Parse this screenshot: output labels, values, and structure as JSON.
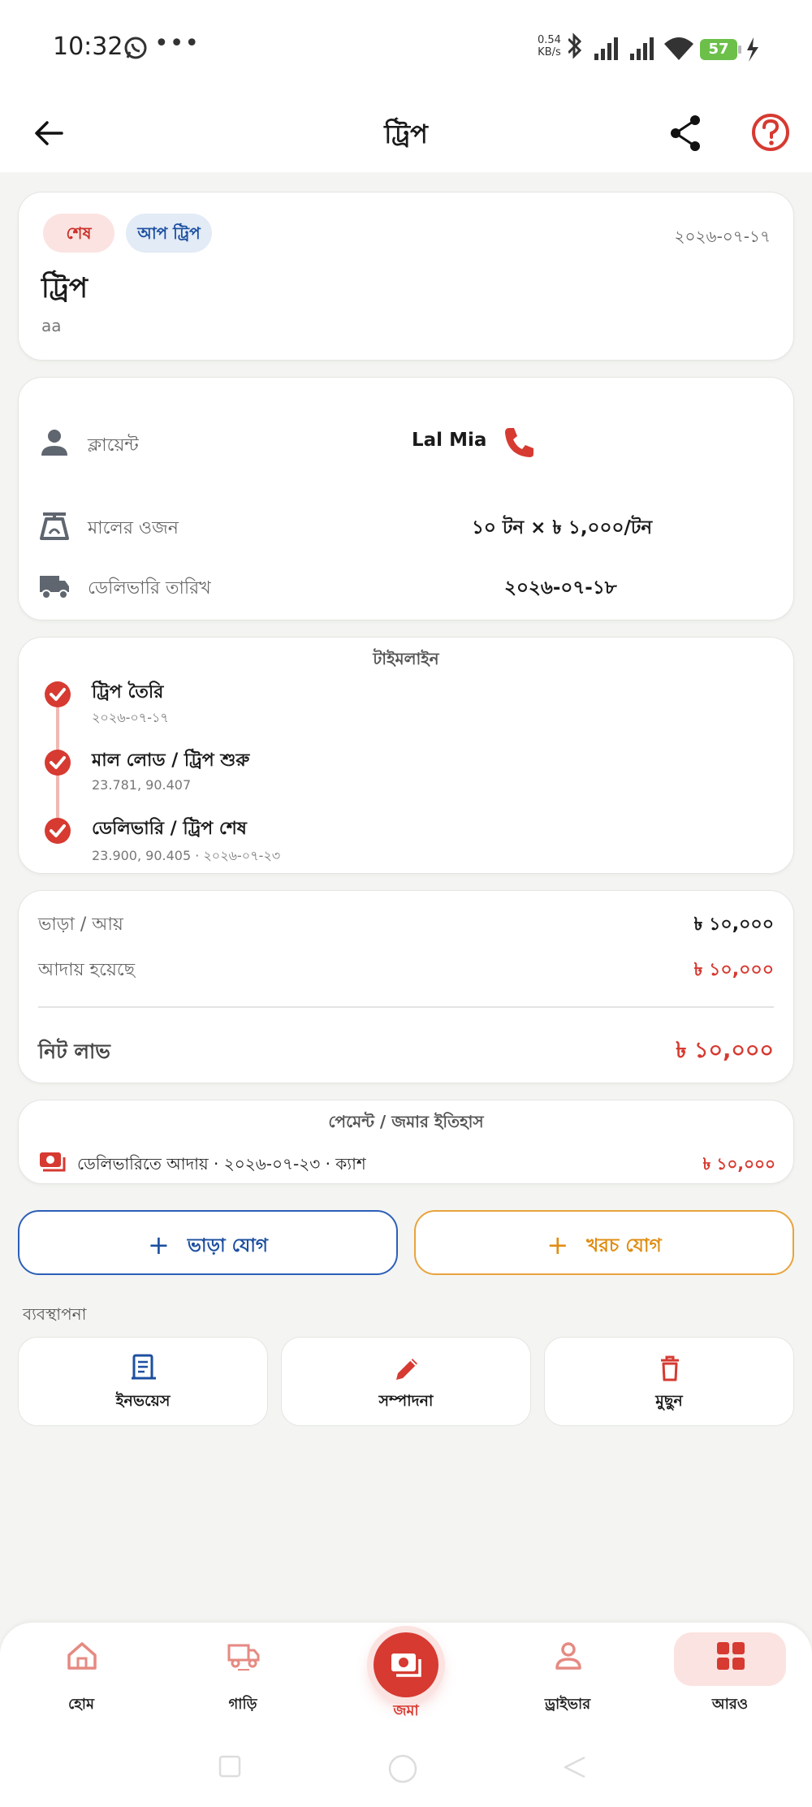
{
  "status_bar": {
    "time": "10:32",
    "more": "•••",
    "net_speed_value": "0.54",
    "net_speed_unit": "KB/s",
    "battery": "57"
  },
  "app_bar": {
    "title": "ট্রিপ",
    "back_icon": "arrow-left-icon",
    "share_icon": "share-icon",
    "help_icon": "help-circle-icon"
  },
  "trip": {
    "status_badge": "শেষ",
    "direction_badge": "আপ ট্রিপ",
    "date": "২০২৬-০৭-১৭",
    "name": "ট্রিপ",
    "note": "aa"
  },
  "details": {
    "client_label": "ক্লায়েন্ট",
    "client_value": "Lal Mia",
    "weight_label": "মালের ওজন",
    "weight_value": "১০ টন × ৳ ১,০০০/টন",
    "delivery_label": "ডেলিভারি তারিখ",
    "delivery_value": "২০২৬-০৭-১৮"
  },
  "timeline": {
    "title": "টাইমলাইন",
    "steps": [
      {
        "title": "ট্রিপ তৈরি",
        "sub": "২০২৬-০৭-১৭"
      },
      {
        "title": "মাল লোড / ট্রিপ শুরু",
        "sub": "23.781, 90.407"
      },
      {
        "title": "ডেলিভারি / ট্রিপ শেষ",
        "sub": "23.900, 90.405 · ২০২৬-০৭-২৩"
      }
    ]
  },
  "finance": {
    "fare_label": "ভাড়া / আয়",
    "fare_value": "৳ ১০,০০০",
    "collected_label": "আদায় হয়েছে",
    "collected_value": "৳ ১০,০০০",
    "profit_label": "নিট লাভ",
    "profit_value": "৳ ১০,০০০"
  },
  "payments": {
    "title": "পেমেন্ট / জমার ইতিহাস",
    "entry_text": "ডেলিভারিতে আদায় · ২০২৬-০৭-২৩ · ক্যাশ",
    "entry_amount": "৳ ১০,০০০"
  },
  "actions": {
    "add_fare": "ভাড়া যোগ",
    "add_cost": "খরচ যোগ",
    "plus": "+"
  },
  "management": {
    "title": "ব্যবস্থাপনা",
    "invoice": "ইনভয়েস",
    "edit": "সম্পাদনা",
    "delete": "মুছুন"
  },
  "bottom_nav": {
    "home": "হোম",
    "vehicles": "গাড়ি",
    "deposit": "জমা",
    "driver": "ড্রাইভার",
    "more": "আরও"
  },
  "colors": {
    "accent": "#d63a31",
    "blue": "#1d4fa0",
    "orange": "#e08d14",
    "background": "#f4f5f2"
  }
}
